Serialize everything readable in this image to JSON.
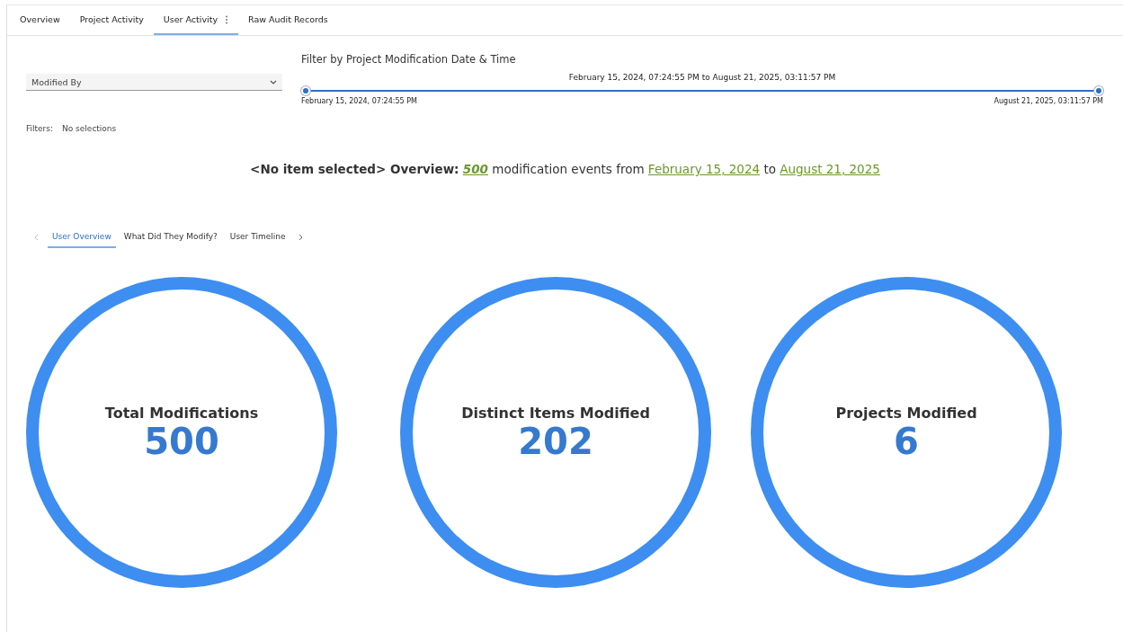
{
  "tabs": [
    {
      "label": "Overview",
      "selected": false,
      "menu": false
    },
    {
      "label": "Project Activity",
      "selected": false,
      "menu": false
    },
    {
      "label": "User Activity",
      "selected": true,
      "menu": true
    },
    {
      "label": "Raw Audit Records",
      "selected": false,
      "menu": false
    }
  ],
  "dropdown": {
    "placeholder": "Modified By"
  },
  "date_filter": {
    "title": "Filter by Project Modification Date & Time",
    "range": "February 15, 2024, 07:24:55 PM to August 21, 2025, 03:11:57 PM",
    "start_label": "February 15, 2024, 07:24:55 PM",
    "end_label": "August 21, 2025, 03:11:57 PM",
    "level": 1
  },
  "filters": {
    "label": "Filters:",
    "value": "No selections"
  },
  "summary": {
    "lead": "<No item selected> Overview:",
    "count": "500",
    "middle": "modification events from",
    "start": "February 15, 2024",
    "joiner": "to",
    "end": "August 21, 2025"
  },
  "subtabs": [
    {
      "label": "User Overview",
      "selected": true
    },
    {
      "label": "What Did They Modify?",
      "selected": false
    },
    {
      "label": "User Timeline",
      "selected": false
    }
  ],
  "metrics": [
    {
      "label": "Total Modifications",
      "value": "500"
    },
    {
      "label": "Distinct Items Modified",
      "value": "202"
    },
    {
      "label": "Projects Modified",
      "value": "6"
    }
  ]
}
